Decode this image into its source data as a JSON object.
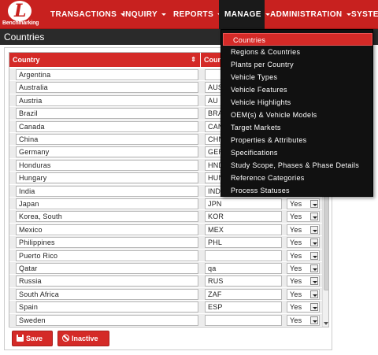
{
  "brand": {
    "logo_text": "Benchmarking"
  },
  "nav": [
    {
      "label": "TRANSACTIONS"
    },
    {
      "label": "INQUIRY"
    },
    {
      "label": "REPORTS"
    },
    {
      "label": "MANAGE"
    },
    {
      "label": "ADMINISTRATION"
    },
    {
      "label": "SYSTEM"
    }
  ],
  "page": {
    "title": "Countries"
  },
  "table": {
    "headers": [
      "Country",
      "Count"
    ],
    "rows": [
      {
        "country": "Argentina",
        "code": "",
        "active": ""
      },
      {
        "country": "Australia",
        "code": "AUS",
        "active": ""
      },
      {
        "country": "Austria",
        "code": "AU",
        "active": ""
      },
      {
        "country": "Brazil",
        "code": "BRA",
        "active": ""
      },
      {
        "country": "Canada",
        "code": "CAN",
        "active": ""
      },
      {
        "country": "China",
        "code": "CHN",
        "active": ""
      },
      {
        "country": "Germany",
        "code": "GER",
        "active": ""
      },
      {
        "country": "Honduras",
        "code": "HND",
        "active": ""
      },
      {
        "country": "Hungary",
        "code": "HUN",
        "active": ""
      },
      {
        "country": "India",
        "code": "IND",
        "active": ""
      },
      {
        "country": "Japan",
        "code": "JPN",
        "active": "Yes"
      },
      {
        "country": "Korea, South",
        "code": "KOR",
        "active": "Yes"
      },
      {
        "country": "Mexico",
        "code": "MEX",
        "active": "Yes"
      },
      {
        "country": "Philippines",
        "code": "PHL",
        "active": "Yes"
      },
      {
        "country": "Puerto Rico",
        "code": "",
        "active": "Yes"
      },
      {
        "country": "Qatar",
        "code": "qa",
        "active": "Yes"
      },
      {
        "country": "Russia",
        "code": "RUS",
        "active": "Yes"
      },
      {
        "country": "South Africa",
        "code": "ZAF",
        "active": "Yes"
      },
      {
        "country": "Spain",
        "code": "ESP",
        "active": "Yes"
      },
      {
        "country": "Sweden",
        "code": "",
        "active": "Yes"
      }
    ]
  },
  "buttons": {
    "save": "Save",
    "inactive": "Inactive"
  },
  "manage_menu": [
    "Countries",
    "Regions & Countries",
    "Plants per Country",
    "Vehicle Types",
    "Vehicle Features",
    "Vehicle Highlights",
    "OEM(s) & Vehicle Models",
    "Target Markets",
    "Properties & Attributes",
    "Specifications",
    "Study Scope, Phases & Phase Details",
    "Reference Categories",
    "Process Statuses"
  ],
  "colors": {
    "brand_red": "#c8211f",
    "menu_bg": "#111111",
    "title_bar": "#2a2a2a"
  }
}
